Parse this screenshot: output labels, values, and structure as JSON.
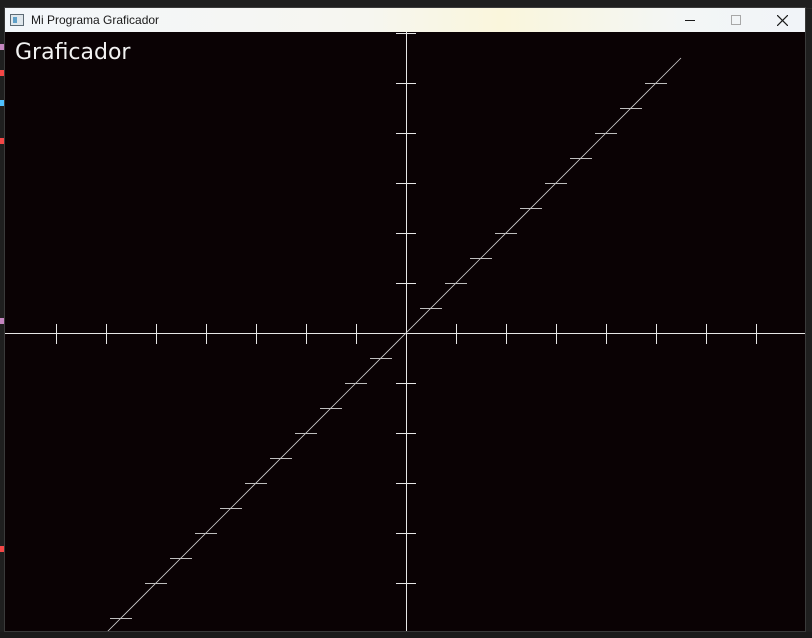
{
  "window": {
    "title": "Mi Programa Graficador",
    "icon": "app-window-icon",
    "controls": [
      "minimize-icon",
      "maximize-icon",
      "close-icon"
    ]
  },
  "canvas": {
    "heading": "Graficador",
    "background": "#0a0204",
    "axis_color": "#e6e6e6"
  },
  "chart_data": {
    "type": "line",
    "title": "",
    "xlabel": "",
    "ylabel": "",
    "xlim": [
      -8,
      8
    ],
    "ylim": [
      -6,
      6
    ],
    "grid": false,
    "x_ticks": [
      -7,
      -6,
      -5,
      -4,
      -3,
      -2,
      -1,
      1,
      2,
      3,
      4,
      5,
      6,
      7
    ],
    "y_ticks": [
      -5,
      -4,
      -3,
      -2,
      -1,
      1,
      2,
      3,
      4,
      5,
      6
    ],
    "series": [
      {
        "function": "y = x",
        "x": [
          -6,
          5.5
        ],
        "y": [
          -6,
          5.5
        ],
        "marker": "horizontal-dash",
        "marker_x": [
          -5.7,
          -5,
          -4.5,
          -4,
          -3.5,
          -3,
          -2.5,
          -2,
          -1.5,
          -1,
          -0.5,
          0.5,
          1,
          1.5,
          2,
          2.5,
          3,
          3.5,
          4,
          4.5,
          5
        ]
      }
    ]
  }
}
